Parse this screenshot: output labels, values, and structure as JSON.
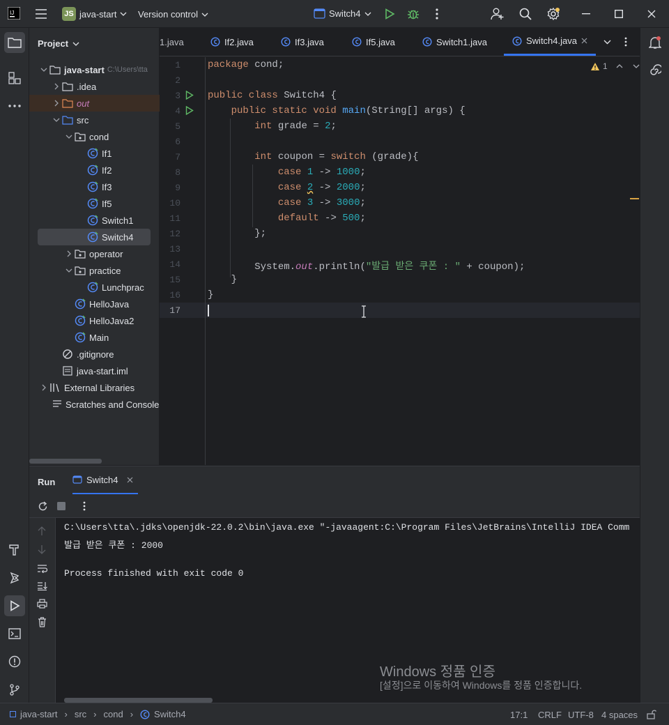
{
  "titlebar": {
    "project_badge": "JS",
    "project_name": "java-start",
    "vcs_label": "Version control",
    "run_config": "Switch4"
  },
  "project_panel": {
    "title": "Project",
    "root_name": "java-start",
    "root_path": "C:\\Users\\tta",
    "items": {
      "idea": ".idea",
      "out": "out",
      "src": "src",
      "cond": "cond",
      "if1": "If1",
      "if2": "If2",
      "if3": "If3",
      "if5": "If5",
      "switch1": "Switch1",
      "switch4": "Switch4",
      "operator": "operator",
      "practice": "practice",
      "lunchprac": "Lunchprac",
      "hellojava": "HelloJava",
      "hellojava2": "HelloJava2",
      "main": "Main",
      "gitignore": ".gitignore",
      "iml": "java-start.iml",
      "external": "External Libraries",
      "scratches": "Scratches and Consoles"
    }
  },
  "editor_tabs": [
    "1.java",
    "If2.java",
    "If3.java",
    "If5.java",
    "Switch1.java",
    "Switch4.java"
  ],
  "editor": {
    "warning_count": "1",
    "line_numbers": [
      "1",
      "2",
      "3",
      "4",
      "5",
      "6",
      "7",
      "8",
      "9",
      "10",
      "11",
      "12",
      "13",
      "14",
      "15",
      "16",
      "17"
    ],
    "code": {
      "l1_kw": "package",
      "l1_rest": " cond;",
      "l3_kw": "public class",
      "l3_rest": " Switch4 {",
      "l4_kw": "public static void",
      "l4_fn": "main",
      "l4_rest": "(String[] args) {",
      "l5_kw": "int",
      "l5_a": " grade = ",
      "l5_num": "2",
      "l5_b": ";",
      "l7_kw": "int",
      "l7_a": " coupon = ",
      "l7_kw2": "switch",
      "l7_b": " (grade){",
      "l8_kw": "case",
      "l8_n1": "1",
      "l8_n2": "1000",
      "l9_kw": "case",
      "l9_n1": "2",
      "l9_n2": "2000",
      "l10_kw": "case",
      "l10_n1": "3",
      "l10_n2": "3000",
      "l11_kw": "default",
      "l11_n2": "500",
      "arrow": " -> ",
      "l12": "};",
      "l14_a": "System.",
      "l14_out": "out",
      "l14_b": ".println(",
      "l14_str": "\"발급 받은 쿠폰 : \"",
      "l14_c": " + coupon);",
      "l15": "}",
      "l16": "}"
    }
  },
  "run_panel": {
    "title": "Run",
    "tab_label": "Switch4",
    "lines": [
      "C:\\Users\\tta\\.jdks\\openjdk-22.0.2\\bin\\java.exe \"-javaagent:C:\\Program Files\\JetBrains\\IntelliJ IDEA Comm",
      "발급 받은 쿠폰 : 2000",
      "",
      "Process finished with exit code 0"
    ]
  },
  "watermark": {
    "title": "Windows 정품 인증",
    "subtitle": "[설정]으로 이동하여 Windows를 정품 인증합니다."
  },
  "statusbar": {
    "breadcrumb": [
      "java-start",
      "src",
      "cond",
      "Switch4"
    ],
    "position": "17:1",
    "line_sep": "CRLF",
    "encoding": "UTF-8",
    "indent": "4 spaces"
  },
  "colors": {
    "accent": "#3574f0",
    "run_green": "#5fb865",
    "keyword": "#cf8e6d",
    "number": "#2aacb8",
    "string": "#6aab73",
    "function": "#56a8f5",
    "warning": "#f2c55c"
  }
}
